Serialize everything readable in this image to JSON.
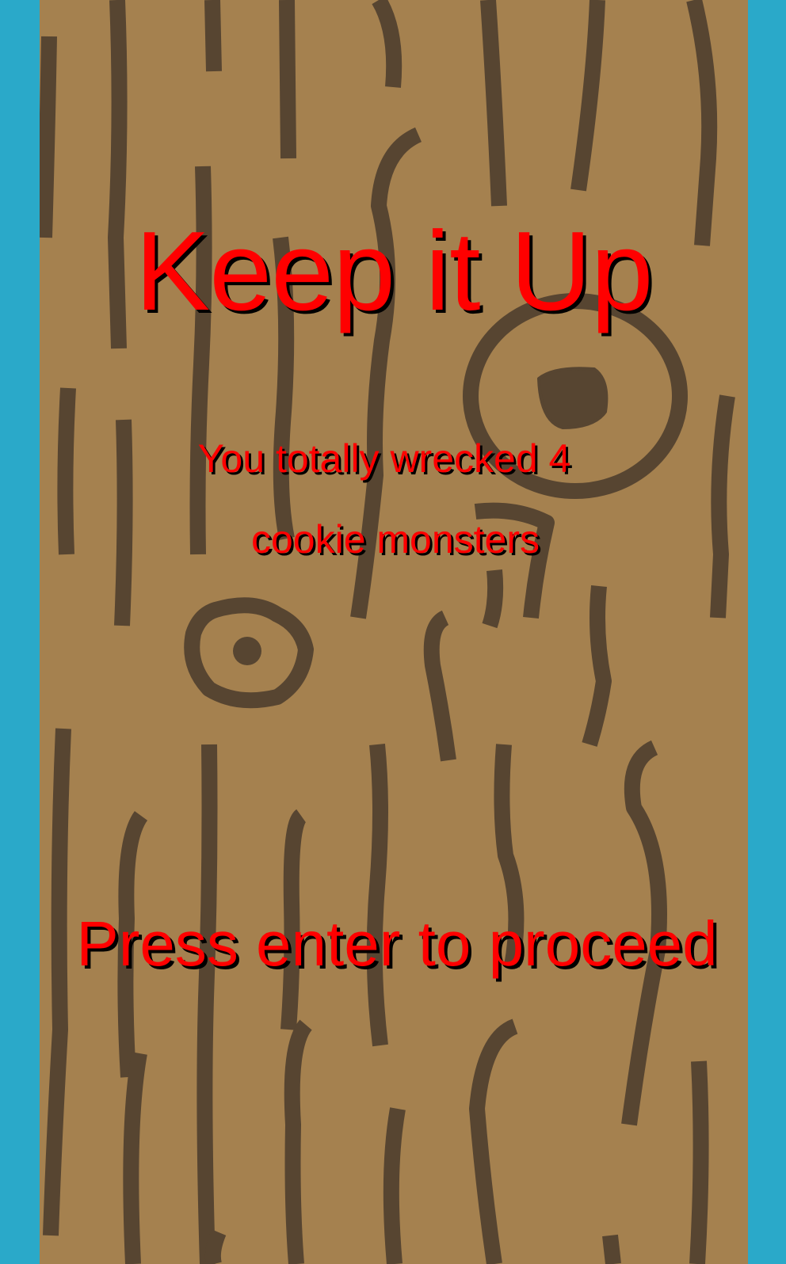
{
  "screen": {
    "title": "Keep it Up",
    "message_line1": "You totally wrecked 4",
    "message_line2": "cookie monsters",
    "prompt": "Press enter to proceed"
  },
  "colors": {
    "border": "#2aa9c9",
    "wood": "#a5814f",
    "grain": "#574531",
    "text": "#ff0000",
    "text_shadow": "#000000"
  }
}
